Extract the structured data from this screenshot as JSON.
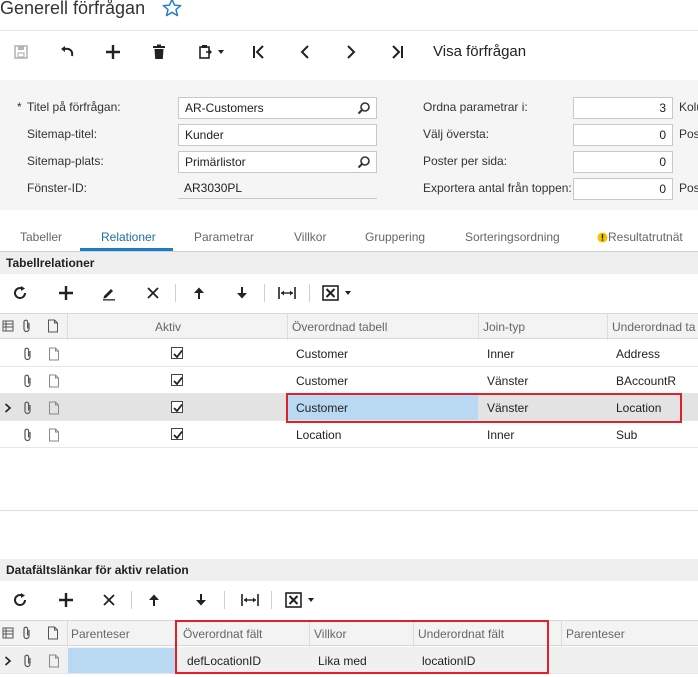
{
  "header": {
    "title": "Generell förfrågan"
  },
  "toolbar": {
    "view_query_label": "Visa förfrågan"
  },
  "form": {
    "title_label": "Titel på förfrågan:",
    "title_value": "AR-Customers",
    "sitemap_title_label": "Sitemap-titel:",
    "sitemap_title_value": "Kunder",
    "sitemap_location_label": "Sitemap-plats:",
    "sitemap_location_value": "Primärlistor",
    "screen_id_label": "Fönster-ID:",
    "screen_id_value": "AR3030PL",
    "arrange_params_label": "Ordna parametrar i:",
    "arrange_params_value": "3",
    "arrange_params_suffix": "Kolu",
    "select_top_label": "Välj översta:",
    "select_top_value": "0",
    "select_top_suffix": "Pos",
    "rows_per_page_label": "Poster per sida:",
    "rows_per_page_value": "0",
    "export_top_label": "Exportera antal från toppen:",
    "export_top_value": "0",
    "export_top_suffix": "Pos"
  },
  "tabs": [
    "Tabeller",
    "Relationer",
    "Parametrar",
    "Villkor",
    "Gruppering",
    "Sorteringsordning",
    "Resultatrutnät"
  ],
  "relations": {
    "section_title": "Tabellrelationer",
    "columns": [
      "Aktiv",
      "Överordnad tabell",
      "Join-typ",
      "Underordnad ta"
    ],
    "rows": [
      {
        "active": true,
        "parent": "Customer",
        "join": "Inner",
        "child": "Address"
      },
      {
        "active": true,
        "parent": "Customer",
        "join": "Vänster",
        "child": "BAccountR"
      },
      {
        "active": true,
        "parent": "Customer",
        "join": "Vänster",
        "child": "Location"
      },
      {
        "active": true,
        "parent": "Location",
        "join": "Inner",
        "child": "Sub"
      }
    ]
  },
  "links": {
    "section_title": "Datafältslänkar för aktiv relation",
    "columns": [
      "Parenteser",
      "Överordnat fält",
      "Villkor",
      "Underordnat fält",
      "Parenteser"
    ],
    "rows": [
      {
        "open_paren": "",
        "parent_field": "defLocationID",
        "condition": "Lika med",
        "child_field": "locationID",
        "close_paren": ""
      }
    ]
  },
  "colors": {
    "accent": "#1a7ec6",
    "highlight": "#e0202a",
    "selection": "#b9d9f2"
  }
}
